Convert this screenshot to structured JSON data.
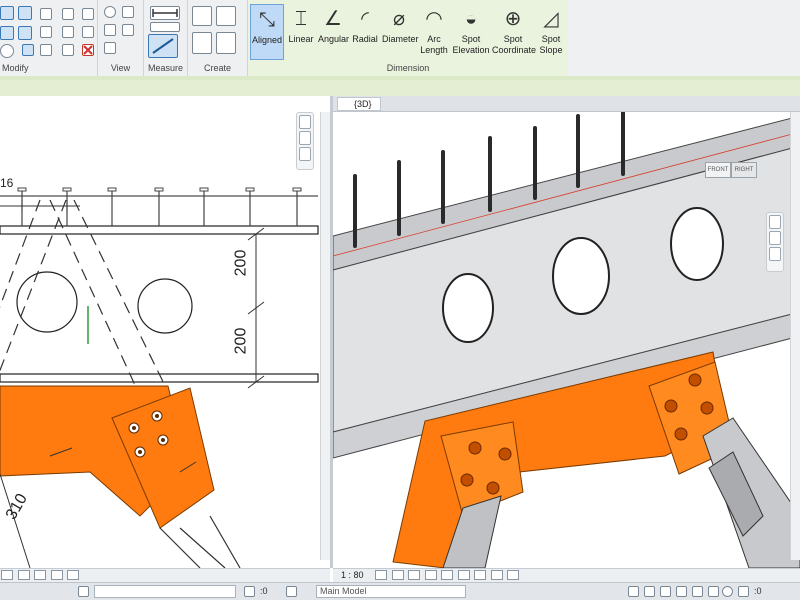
{
  "ribbon": {
    "panels": {
      "modify": "Modify",
      "view": "View",
      "measure": "Measure",
      "create": "Create",
      "dimension": "Dimension"
    },
    "dimension_tools": [
      {
        "label": "Aligned",
        "icon": "aligned-dimension-icon",
        "active": true
      },
      {
        "label": "Linear",
        "icon": "linear-dimension-icon",
        "active": false
      },
      {
        "label": "Angular",
        "icon": "angular-dimension-icon",
        "active": false
      },
      {
        "label": "Radial",
        "icon": "radial-dimension-icon",
        "active": false
      },
      {
        "label": "Diameter",
        "icon": "diameter-dimension-icon",
        "active": false
      },
      {
        "label": "Arc Length",
        "icon": "arc-length-dimension-icon",
        "active": false
      },
      {
        "label": "Spot Elevation",
        "icon": "spot-elevation-icon",
        "active": false
      },
      {
        "label": "Spot Coordinate",
        "icon": "spot-coordinate-icon",
        "active": false
      },
      {
        "label": "Spot Slope",
        "icon": "spot-slope-icon",
        "active": false
      }
    ]
  },
  "left_view": {
    "dimensions": [
      "200",
      "200",
      "310"
    ],
    "partial_label": "16"
  },
  "right_view": {
    "tab_title": "{3D}",
    "viewcube": {
      "front": "FRONT",
      "right": "RIGHT"
    }
  },
  "view_control_bar": {
    "scale": "1 : 80"
  },
  "status_bar": {
    "workset_value": ":0",
    "model": "Main Model",
    "filter_value": ":0"
  },
  "colors": {
    "steel_orange": "#ff7a0f",
    "beam_gray": "#d7d8da",
    "ribbon_bg": "#eef0f2",
    "active_tool": "#bfdaf6",
    "dimension_panel": "#eaf3de"
  }
}
